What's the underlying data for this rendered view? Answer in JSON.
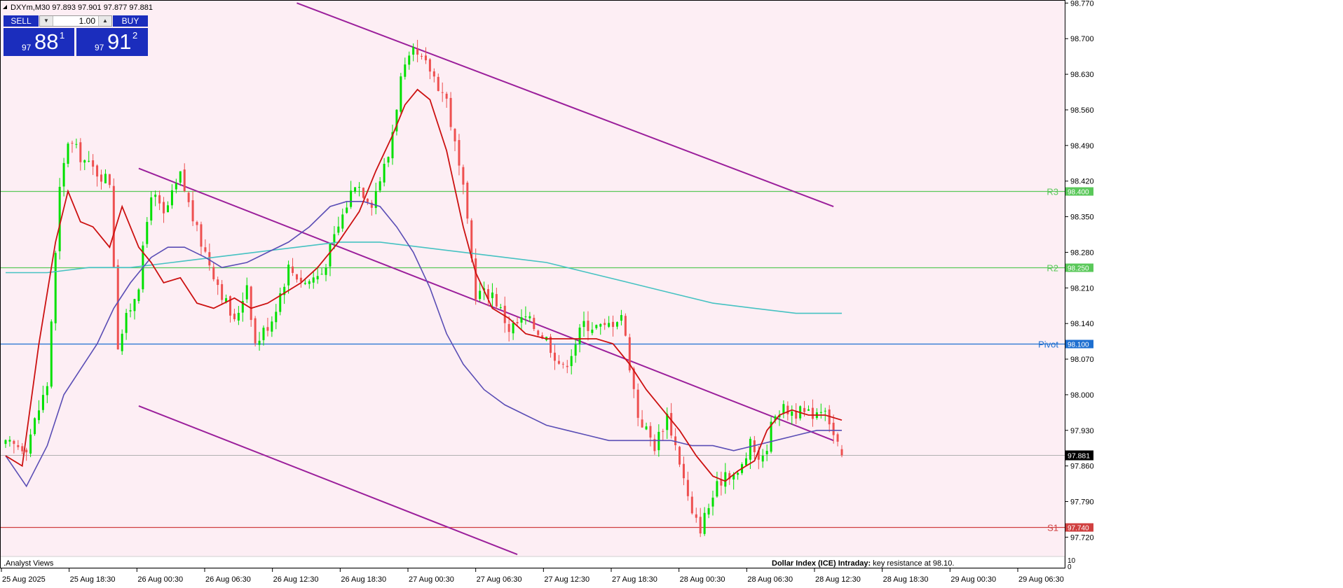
{
  "header": {
    "symbol_line": "DXYm,M30  97.893 97.901 97.877 97.881"
  },
  "trade_panel": {
    "sell_label": "SELL",
    "buy_label": "BUY",
    "lot_value": "1.00",
    "bid_prefix": "97",
    "bid_big": "88",
    "bid_sup": "1",
    "ask_prefix": "97",
    "ask_big": "91",
    "ask_sup": "2"
  },
  "indicator_window_label": ".Analyst Views",
  "indicator_scale": [
    "10",
    "0"
  ],
  "footer_text_bold": "Dollar Index (ICE) Intraday:",
  "footer_text": " key resistance at 98.10.",
  "colors": {
    "background": "#fdeef4",
    "bull": "#00e000",
    "bear": "#ee5050",
    "trendline": "#9b1f9b",
    "ma_fast": "#cc1010",
    "ma_mid": "#5a4db5",
    "ma_slow": "#46c2c2",
    "r_level": "#5ac85a",
    "pivot": "#1e6fd0",
    "s1": "#d04040",
    "grid_current": "#b0b0b0"
  },
  "chart_data": {
    "type": "candlestick",
    "symbol": "DXYm",
    "timeframe": "M30",
    "ohlc_current": {
      "open": 97.893,
      "high": 97.901,
      "low": 97.877,
      "close": 97.881
    },
    "ylim": [
      97.682,
      98.776
    ],
    "y_ticks": [
      "98.770",
      "98.700",
      "98.630",
      "98.560",
      "98.490",
      "98.420",
      "98.350",
      "98.280",
      "98.210",
      "98.140",
      "98.070",
      "98.000",
      "97.930",
      "97.860",
      "97.790",
      "97.720"
    ],
    "x_ticks": [
      "25 Aug 2025",
      "25 Aug 18:30",
      "26 Aug 00:30",
      "26 Aug 06:30",
      "26 Aug 12:30",
      "26 Aug 18:30",
      "27 Aug 00:30",
      "27 Aug 06:30",
      "27 Aug 12:30",
      "27 Aug 18:30",
      "28 Aug 00:30",
      "28 Aug 06:30",
      "28 Aug 12:30",
      "28 Aug 18:30",
      "29 Aug 00:30",
      "29 Aug 06:30"
    ],
    "bar_count": 202,
    "levels": [
      {
        "name": "R3",
        "value": 98.4,
        "price_label": "98.400",
        "color": "#5ac85a"
      },
      {
        "name": "R2",
        "value": 98.25,
        "price_label": "98.250",
        "color": "#5ac85a"
      },
      {
        "name": "Pivot",
        "value": 98.1,
        "price_label": "98.100",
        "color": "#1e6fd0"
      },
      {
        "name": "S1",
        "value": 97.74,
        "price_label": "97.740",
        "color": "#d04040"
      }
    ],
    "current_price": {
      "value": 97.881,
      "label": "97.881"
    },
    "trendlines": [
      {
        "name": "channel-upper",
        "points": [
          [
            70,
            98.77
          ],
          [
            199,
            98.37
          ]
        ]
      },
      {
        "name": "channel-middle",
        "points": [
          [
            32,
            98.445
          ],
          [
            199,
            97.91
          ]
        ]
      },
      {
        "name": "channel-lower",
        "points": [
          [
            32,
            97.978
          ],
          [
            123,
            97.686
          ]
        ]
      }
    ],
    "anchors": [
      [
        0,
        97.9
      ],
      [
        5,
        97.9
      ],
      [
        10,
        98.02
      ],
      [
        13,
        98.4
      ],
      [
        15,
        98.5
      ],
      [
        20,
        98.45
      ],
      [
        25,
        98.42
      ],
      [
        27,
        98.1
      ],
      [
        32,
        98.22
      ],
      [
        35,
        98.4
      ],
      [
        38,
        98.35
      ],
      [
        42,
        98.43
      ],
      [
        46,
        98.32
      ],
      [
        50,
        98.24
      ],
      [
        55,
        98.14
      ],
      [
        58,
        98.22
      ],
      [
        60,
        98.1
      ],
      [
        64,
        98.15
      ],
      [
        68,
        98.25
      ],
      [
        72,
        98.22
      ],
      [
        76,
        98.24
      ],
      [
        80,
        98.33
      ],
      [
        84,
        98.42
      ],
      [
        88,
        98.38
      ],
      [
        92,
        98.47
      ],
      [
        95,
        98.62
      ],
      [
        98,
        98.67
      ],
      [
        102,
        98.64
      ],
      [
        106,
        98.58
      ],
      [
        110,
        98.4
      ],
      [
        113,
        98.2
      ],
      [
        117,
        98.2
      ],
      [
        121,
        98.13
      ],
      [
        125,
        98.15
      ],
      [
        130,
        98.11
      ],
      [
        134,
        98.05
      ],
      [
        139,
        98.14
      ],
      [
        144,
        98.13
      ],
      [
        148,
        98.16
      ],
      [
        152,
        97.96
      ],
      [
        156,
        97.9
      ],
      [
        159,
        97.96
      ],
      [
        162,
        97.87
      ],
      [
        165,
        97.76
      ],
      [
        167,
        97.74
      ],
      [
        170,
        97.8
      ],
      [
        173,
        97.85
      ],
      [
        176,
        97.84
      ],
      [
        179,
        97.9
      ],
      [
        182,
        97.87
      ],
      [
        185,
        97.97
      ],
      [
        188,
        97.97
      ],
      [
        193,
        97.96
      ],
      [
        197,
        97.98
      ],
      [
        199,
        97.92
      ],
      [
        201,
        97.881
      ]
    ],
    "ma_fast": [
      [
        0,
        97.88
      ],
      [
        4,
        97.86
      ],
      [
        8,
        98.1
      ],
      [
        12,
        98.3
      ],
      [
        15,
        98.4
      ],
      [
        18,
        98.34
      ],
      [
        21,
        98.33
      ],
      [
        25,
        98.29
      ],
      [
        28,
        98.37
      ],
      [
        32,
        98.29
      ],
      [
        35,
        98.26
      ],
      [
        38,
        98.22
      ],
      [
        42,
        98.23
      ],
      [
        46,
        98.18
      ],
      [
        50,
        98.17
      ],
      [
        55,
        98.19
      ],
      [
        59,
        98.17
      ],
      [
        63,
        98.18
      ],
      [
        67,
        98.2
      ],
      [
        71,
        98.22
      ],
      [
        75,
        98.25
      ],
      [
        80,
        98.3
      ],
      [
        85,
        98.36
      ],
      [
        89,
        98.44
      ],
      [
        93,
        98.51
      ],
      [
        96,
        98.57
      ],
      [
        99,
        98.6
      ],
      [
        102,
        98.58
      ],
      [
        106,
        98.48
      ],
      [
        110,
        98.33
      ],
      [
        113,
        98.24
      ],
      [
        117,
        98.17
      ],
      [
        121,
        98.15
      ],
      [
        125,
        98.12
      ],
      [
        130,
        98.11
      ],
      [
        134,
        98.11
      ],
      [
        138,
        98.11
      ],
      [
        142,
        98.11
      ],
      [
        146,
        98.1
      ],
      [
        150,
        98.06
      ],
      [
        154,
        98.01
      ],
      [
        158,
        97.97
      ],
      [
        162,
        97.93
      ],
      [
        166,
        97.88
      ],
      [
        170,
        97.84
      ],
      [
        173,
        97.83
      ],
      [
        176,
        97.85
      ],
      [
        180,
        97.87
      ],
      [
        183,
        97.93
      ],
      [
        186,
        97.96
      ],
      [
        189,
        97.97
      ],
      [
        193,
        97.96
      ],
      [
        197,
        97.96
      ],
      [
        201,
        97.95
      ]
    ],
    "ma_mid": [
      [
        0,
        97.88
      ],
      [
        5,
        97.82
      ],
      [
        10,
        97.9
      ],
      [
        14,
        98.0
      ],
      [
        18,
        98.05
      ],
      [
        22,
        98.1
      ],
      [
        26,
        98.17
      ],
      [
        30,
        98.22
      ],
      [
        35,
        98.27
      ],
      [
        39,
        98.29
      ],
      [
        43,
        98.29
      ],
      [
        48,
        98.27
      ],
      [
        52,
        98.25
      ],
      [
        58,
        98.26
      ],
      [
        63,
        98.28
      ],
      [
        68,
        98.3
      ],
      [
        73,
        98.33
      ],
      [
        78,
        98.37
      ],
      [
        82,
        98.38
      ],
      [
        86,
        98.38
      ],
      [
        90,
        98.37
      ],
      [
        94,
        98.33
      ],
      [
        98,
        98.28
      ],
      [
        102,
        98.21
      ],
      [
        106,
        98.12
      ],
      [
        110,
        98.06
      ],
      [
        115,
        98.01
      ],
      [
        120,
        97.98
      ],
      [
        125,
        97.96
      ],
      [
        130,
        97.94
      ],
      [
        135,
        97.93
      ],
      [
        140,
        97.92
      ],
      [
        145,
        97.91
      ],
      [
        150,
        97.91
      ],
      [
        155,
        97.91
      ],
      [
        160,
        97.91
      ],
      [
        165,
        97.9
      ],
      [
        170,
        97.9
      ],
      [
        175,
        97.89
      ],
      [
        180,
        97.9
      ],
      [
        185,
        97.91
      ],
      [
        190,
        97.92
      ],
      [
        195,
        97.93
      ],
      [
        201,
        97.93
      ]
    ],
    "ma_slow": [
      [
        0,
        98.24
      ],
      [
        10,
        98.24
      ],
      [
        20,
        98.25
      ],
      [
        30,
        98.25
      ],
      [
        40,
        98.26
      ],
      [
        50,
        98.27
      ],
      [
        60,
        98.28
      ],
      [
        70,
        98.29
      ],
      [
        80,
        98.3
      ],
      [
        90,
        98.3
      ],
      [
        100,
        98.29
      ],
      [
        110,
        98.28
      ],
      [
        120,
        98.27
      ],
      [
        130,
        98.26
      ],
      [
        140,
        98.24
      ],
      [
        150,
        98.22
      ],
      [
        160,
        98.2
      ],
      [
        170,
        98.18
      ],
      [
        180,
        98.17
      ],
      [
        190,
        98.16
      ],
      [
        200,
        98.16
      ],
      [
        201,
        98.16
      ]
    ]
  }
}
